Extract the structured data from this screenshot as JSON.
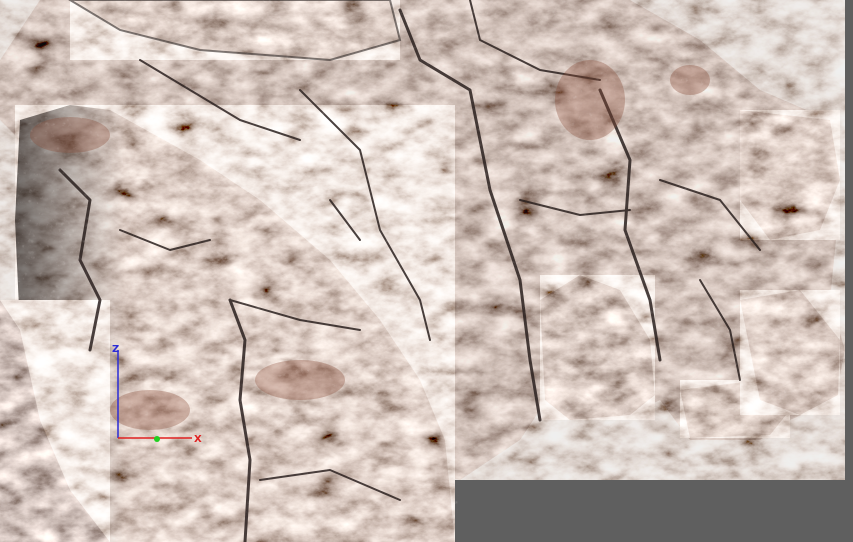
{
  "viewport": {
    "background_color": "#5f5f5f",
    "model": "rock-cliff",
    "rock_colors": {
      "dark": "#3b312f",
      "mid": "#7d6a64",
      "light": "#b8aaa4",
      "rust": "#8a4e3a",
      "highlight": "#d9cfcb"
    }
  },
  "gizmo": {
    "z_label": "Z",
    "x_label": "X",
    "z_color": "#2b2bd6",
    "x_color": "#e02020",
    "y_color": "#20d020"
  }
}
